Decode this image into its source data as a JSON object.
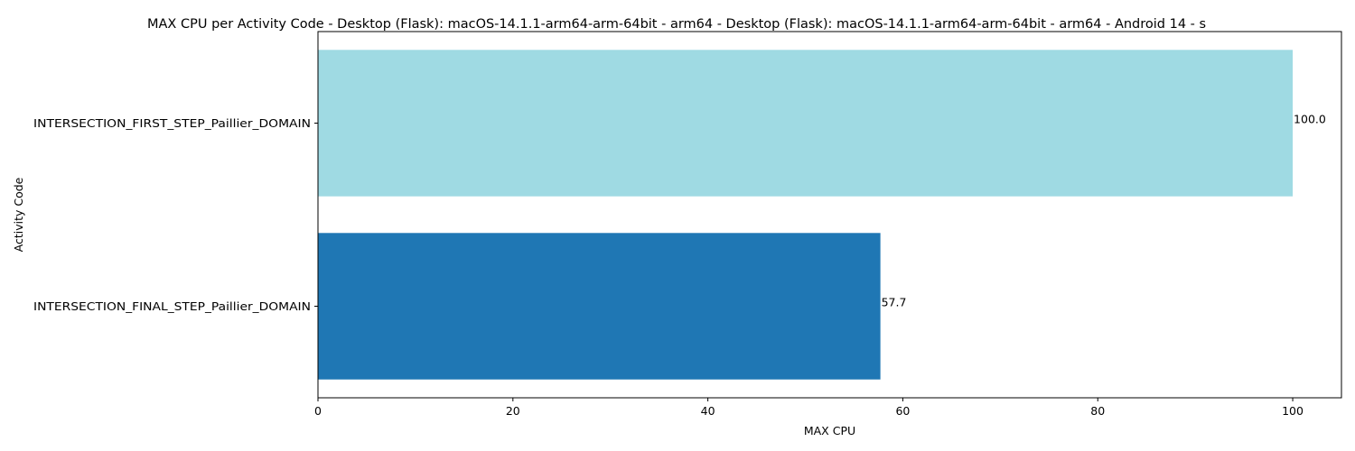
{
  "chart_data": {
    "type": "bar",
    "orientation": "horizontal",
    "title": "MAX CPU per Activity Code - Desktop (Flask): macOS-14.1.1-arm64-arm-64bit - arm64 - Desktop (Flask): macOS-14.1.1-arm64-arm-64bit - arm64 - Android 14 - s",
    "xlabel": "MAX CPU",
    "ylabel": "Activity Code",
    "categories": [
      "INTERSECTION_FIRST_STEP_Paillier_DOMAIN",
      "INTERSECTION_FINAL_STEP_Paillier_DOMAIN"
    ],
    "values": [
      100.0,
      57.7
    ],
    "data_labels": [
      "100.0",
      "57.7"
    ],
    "colors": [
      "#9fdae3",
      "#1f77b4"
    ],
    "xlim": [
      0,
      105
    ],
    "xticks": [
      0,
      20,
      40,
      60,
      80,
      100
    ],
    "grid": false
  }
}
